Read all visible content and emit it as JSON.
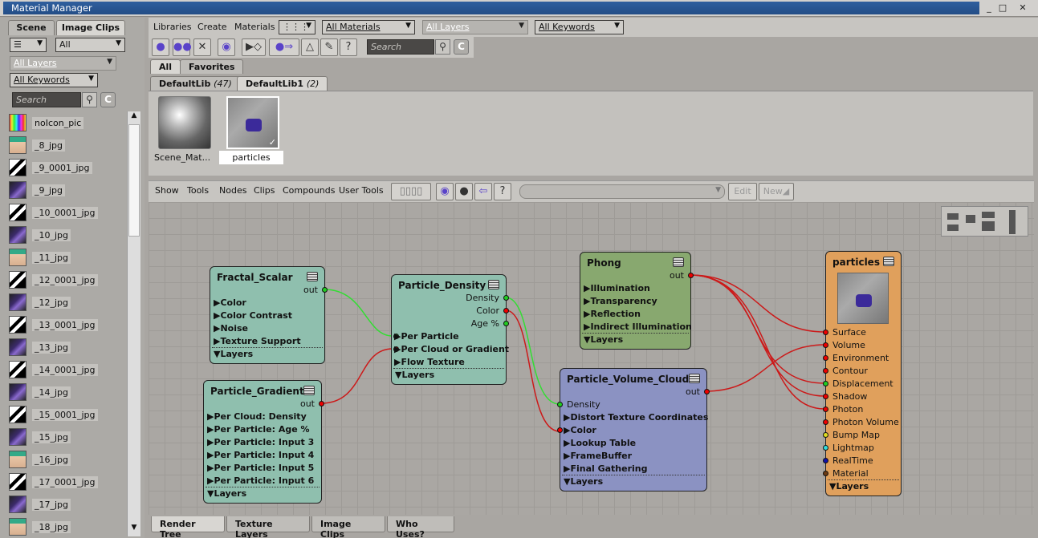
{
  "window": {
    "title": "Material Manager",
    "buttons": [
      "_",
      "□",
      "✕"
    ]
  },
  "left": {
    "tabs": [
      "Scene",
      "Image Clips"
    ],
    "view_combo": "All",
    "layers_combo": "All Layers",
    "keywords_combo": "All Keywords",
    "search_placeholder": "Search",
    "clear_label": "C",
    "items": [
      {
        "name": "noIcon_pic",
        "thumb": "rainbow"
      },
      {
        "name": "_8_jpg",
        "thumb": "face"
      },
      {
        "name": "_9_0001_jpg",
        "thumb": "bw"
      },
      {
        "name": "_9_jpg",
        "thumb": "purple"
      },
      {
        "name": "_10_0001_jpg",
        "thumb": "bw"
      },
      {
        "name": "_10_jpg",
        "thumb": "purple"
      },
      {
        "name": "_11_jpg",
        "thumb": "face"
      },
      {
        "name": "_12_0001_jpg",
        "thumb": "bw"
      },
      {
        "name": "_12_jpg",
        "thumb": "purple"
      },
      {
        "name": "_13_0001_jpg",
        "thumb": "bw"
      },
      {
        "name": "_13_jpg",
        "thumb": "purple"
      },
      {
        "name": "_14_0001_jpg",
        "thumb": "bw"
      },
      {
        "name": "_14_jpg",
        "thumb": "purple"
      },
      {
        "name": "_15_0001_jpg",
        "thumb": "bw"
      },
      {
        "name": "_15_jpg",
        "thumb": "purple"
      },
      {
        "name": "_16_jpg",
        "thumb": "face"
      },
      {
        "name": "_17_0001_jpg",
        "thumb": "bw"
      },
      {
        "name": "_17_jpg",
        "thumb": "purple"
      },
      {
        "name": "_18_jpg",
        "thumb": "face"
      }
    ]
  },
  "menubar": {
    "items": [
      "Libraries",
      "Create",
      "Materials"
    ],
    "materials_combo": "All Materials",
    "layers_combo": "All Layers",
    "keywords_combo": "All Keywords"
  },
  "toolbar": {
    "search_placeholder": "Search",
    "clear_label": "C"
  },
  "filter_tabs": [
    "All",
    "Favorites"
  ],
  "libraries": [
    {
      "name": "DefaultLib",
      "count": "(47)"
    },
    {
      "name": "DefaultLib1",
      "count": "(2)"
    }
  ],
  "materials": [
    {
      "label": "Scene_Mat...",
      "selected": false
    },
    {
      "label": "particles",
      "selected": true
    }
  ],
  "graph_menu": {
    "items": [
      "Show",
      "Tools",
      "Nodes",
      "Clips",
      "Compounds",
      "User Tools"
    ],
    "edit_label": "Edit",
    "new_label": "New"
  },
  "nodes": {
    "fractal": {
      "title": "Fractal_Scalar",
      "out": "out",
      "params": [
        "▶Color",
        "▶Color Contrast",
        "▶Noise",
        "▶Texture Support"
      ],
      "layers": "▼Layers"
    },
    "gradient": {
      "title": "Particle_Gradient",
      "out": "out",
      "params": [
        "▶Per Cloud: Density",
        "▶Per Particle: Age %",
        "▶Per Particle: Input 3",
        "▶Per Particle: Input 4",
        "▶Per Particle: Input 5",
        "▶Per Particle: Input 6"
      ],
      "layers": "▼Layers"
    },
    "density": {
      "title": "Particle_Density",
      "outs": [
        "Density",
        "Color",
        "Age %"
      ],
      "params": [
        "▶Per Particle",
        "▶Per Cloud or Gradient",
        "▶Flow Texture"
      ],
      "layers": "▼Layers"
    },
    "phong": {
      "title": "Phong",
      "out": "out",
      "params": [
        "▶Illumination",
        "▶Transparency",
        "▶Reflection",
        "▶Indirect Illumination"
      ],
      "layers": "▼Layers"
    },
    "volume": {
      "title": "Particle_Volume_Cloud",
      "out": "out",
      "input": "Density",
      "params": [
        "▶Distort Texture Coordinates",
        "▶Color",
        "▶Lookup Table",
        "▶FrameBuffer",
        "▶Final Gathering"
      ],
      "layers": "▼Layers"
    },
    "particles": {
      "title": "particles",
      "inputs": [
        "Surface",
        "Volume",
        "Environment",
        "Contour",
        "Displacement",
        "Shadow",
        "Photon",
        "Photon Volume",
        "Bump Map",
        "Lightmap",
        "RealTime",
        "Material"
      ],
      "layers": "▼Layers"
    }
  },
  "bottom_tabs": [
    "Render Tree",
    "Texture Layers",
    "Image Clips",
    "Who Uses?"
  ],
  "colors": {
    "node_teal": "#8fbfae",
    "node_green": "#88a86f",
    "node_blue": "#8b92c2",
    "node_orange": "#e0a05c",
    "wire_red": "#cc1a1a",
    "wire_green": "#33dd33"
  }
}
